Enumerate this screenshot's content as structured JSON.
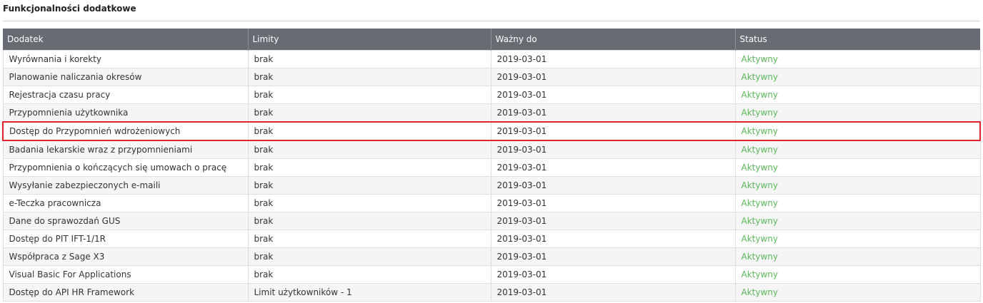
{
  "section": {
    "title": "Funkcjonalności dodatkowe"
  },
  "table": {
    "headers": [
      "Dodatek",
      "Limity",
      "Ważny do",
      "Status"
    ],
    "rows": [
      {
        "name": "Wyrównania i korekty",
        "limit": "brak",
        "valid_until": "2019-03-01",
        "status": "Aktywny"
      },
      {
        "name": "Planowanie naliczania okresów",
        "limit": "brak",
        "valid_until": "2019-03-01",
        "status": "Aktywny"
      },
      {
        "name": "Rejestracja czasu pracy",
        "limit": "brak",
        "valid_until": "2019-03-01",
        "status": "Aktywny"
      },
      {
        "name": "Przypomnienia użytkownika",
        "limit": "brak",
        "valid_until": "2019-03-01",
        "status": "Aktywny"
      },
      {
        "name": "Dostęp do Przypomnień wdrożeniowych",
        "limit": "brak",
        "valid_until": "2019-03-01",
        "status": "Aktywny"
      },
      {
        "name": "Badania lekarskie wraz z przypomnieniami",
        "limit": "brak",
        "valid_until": "2019-03-01",
        "status": "Aktywny"
      },
      {
        "name": "Przypomnienia o kończących się umowach o pracę",
        "limit": "brak",
        "valid_until": "2019-03-01",
        "status": "Aktywny"
      },
      {
        "name": "Wysyłanie zabezpieczonych e-maili",
        "limit": "brak",
        "valid_until": "2019-03-01",
        "status": "Aktywny"
      },
      {
        "name": "e-Teczka pracownicza",
        "limit": "brak",
        "valid_until": "2019-03-01",
        "status": "Aktywny"
      },
      {
        "name": "Dane do sprawozdań GUS",
        "limit": "brak",
        "valid_until": "2019-03-01",
        "status": "Aktywny"
      },
      {
        "name": "Dostęp do PIT IFT-1/1R",
        "limit": "brak",
        "valid_until": "2019-03-01",
        "status": "Aktywny"
      },
      {
        "name": "Współpraca z Sage X3",
        "limit": "brak",
        "valid_until": "2019-03-01",
        "status": "Aktywny"
      },
      {
        "name": "Visual Basic For Applications",
        "limit": "brak",
        "valid_until": "2019-03-01",
        "status": "Aktywny"
      },
      {
        "name": "Dostęp do API HR Framework",
        "limit": "Limit użytkowników - 1",
        "valid_until": "2019-03-01",
        "status": "Aktywny"
      }
    ]
  },
  "colors": {
    "header_bg": "#676b72",
    "status_active": "#5cb85c",
    "highlight_border": "#e0262c"
  }
}
